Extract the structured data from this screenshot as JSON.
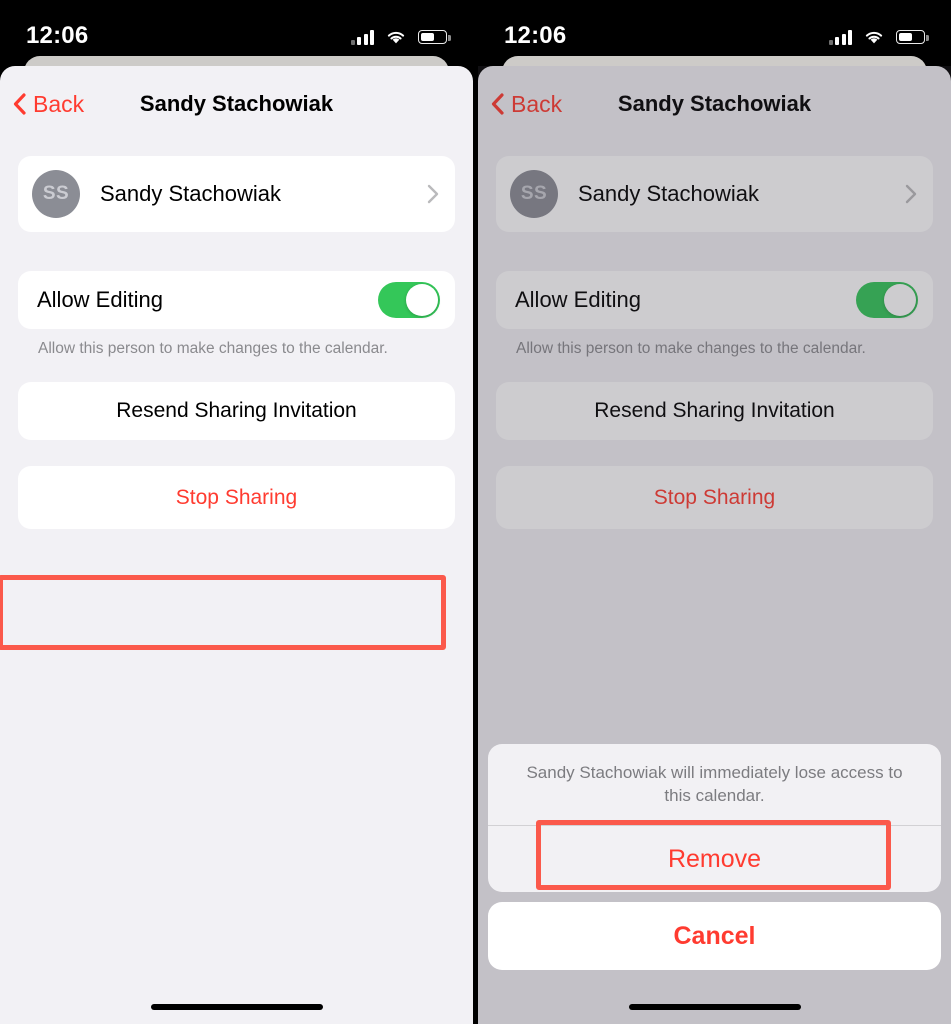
{
  "status_bar": {
    "time": "12:06",
    "signal_icon": "cellular-signal-icon",
    "wifi_icon": "wifi-icon",
    "battery_icon": "battery-icon",
    "battery_level_pct": 50
  },
  "nav": {
    "back_label": "Back",
    "back_icon": "chevron-left-icon",
    "title": "Sandy Stachowiak"
  },
  "person_row": {
    "initials": "SS",
    "name": "Sandy Stachowiak",
    "disclosure_icon": "chevron-right-icon"
  },
  "allow_editing": {
    "label": "Allow Editing",
    "value": "on",
    "footnote": "Allow this person to make changes to the calendar."
  },
  "buttons": {
    "resend": "Resend Sharing Invitation",
    "stop_sharing": "Stop Sharing"
  },
  "action_sheet": {
    "message": "Sandy Stachowiak will immediately lose access to this calendar.",
    "remove": "Remove",
    "cancel": "Cancel"
  },
  "colors": {
    "accent_red": "#FF3B30",
    "annotation_red": "#FB594B",
    "toggle_green": "#34C759",
    "screen_bg": "#F2F1F5",
    "card_bg": "#FFFFFF",
    "avatar_bg": "#8B8D95",
    "dim_overlay": "#C1C0C6"
  },
  "panels": [
    {
      "name": "before-stop-sharing-tapped",
      "annotated_target": "Stop Sharing"
    },
    {
      "name": "confirm-remove-action-sheet",
      "annotated_target": "Remove"
    }
  ]
}
